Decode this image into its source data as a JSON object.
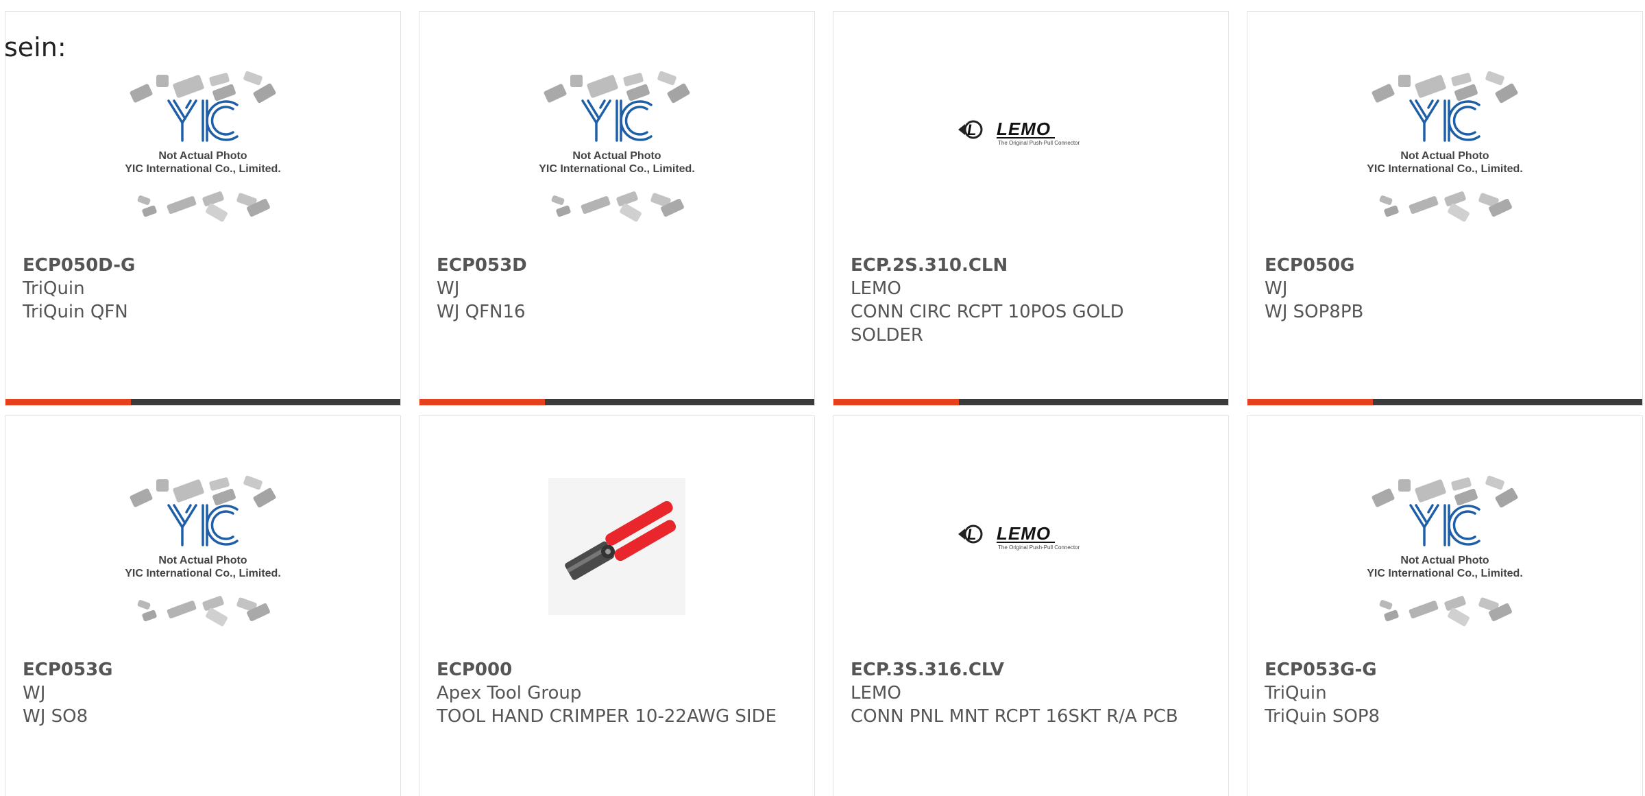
{
  "fragment_text": "sein:",
  "colors": {
    "accent": "#e8401c",
    "bar": "#3b3b3b",
    "text": "#555555",
    "yic_blue": "#1f5fa8",
    "crimper_red": "#e8262b"
  },
  "placeholder_text": {
    "line1": "Not Actual Photo",
    "line2": "YIC International Co., Limited."
  },
  "lemo_text": {
    "brand": "LEMO",
    "tagline": "The Original Push-Pull Connector"
  },
  "products": [
    {
      "part": "ECP050D-G",
      "manufacturer": "TriQuin",
      "description": "TriQuin QFN",
      "image": "yic-placeholder"
    },
    {
      "part": "ECP053D",
      "manufacturer": "WJ",
      "description": "WJ QFN16",
      "image": "yic-placeholder"
    },
    {
      "part": "ECP.2S.310.CLN",
      "manufacturer": "LEMO",
      "description": "CONN CIRC RCPT 10POS GOLD SOLDER",
      "image": "lemo-logo"
    },
    {
      "part": "ECP050G",
      "manufacturer": "WJ",
      "description": "WJ SOP8PB",
      "image": "yic-placeholder"
    },
    {
      "part": "ECP053G",
      "manufacturer": "WJ",
      "description": "WJ SO8",
      "image": "yic-placeholder"
    },
    {
      "part": "ECP000",
      "manufacturer": "Apex Tool Group",
      "description": "TOOL HAND CRIMPER 10-22AWG SIDE",
      "image": "crimper-photo"
    },
    {
      "part": "ECP.3S.316.CLV",
      "manufacturer": "LEMO",
      "description": "CONN PNL MNT RCPT 16SKT R/A PCB",
      "image": "lemo-logo"
    },
    {
      "part": "ECP053G-G",
      "manufacturer": "TriQuin",
      "description": "TriQuin SOP8",
      "image": "yic-placeholder"
    }
  ]
}
